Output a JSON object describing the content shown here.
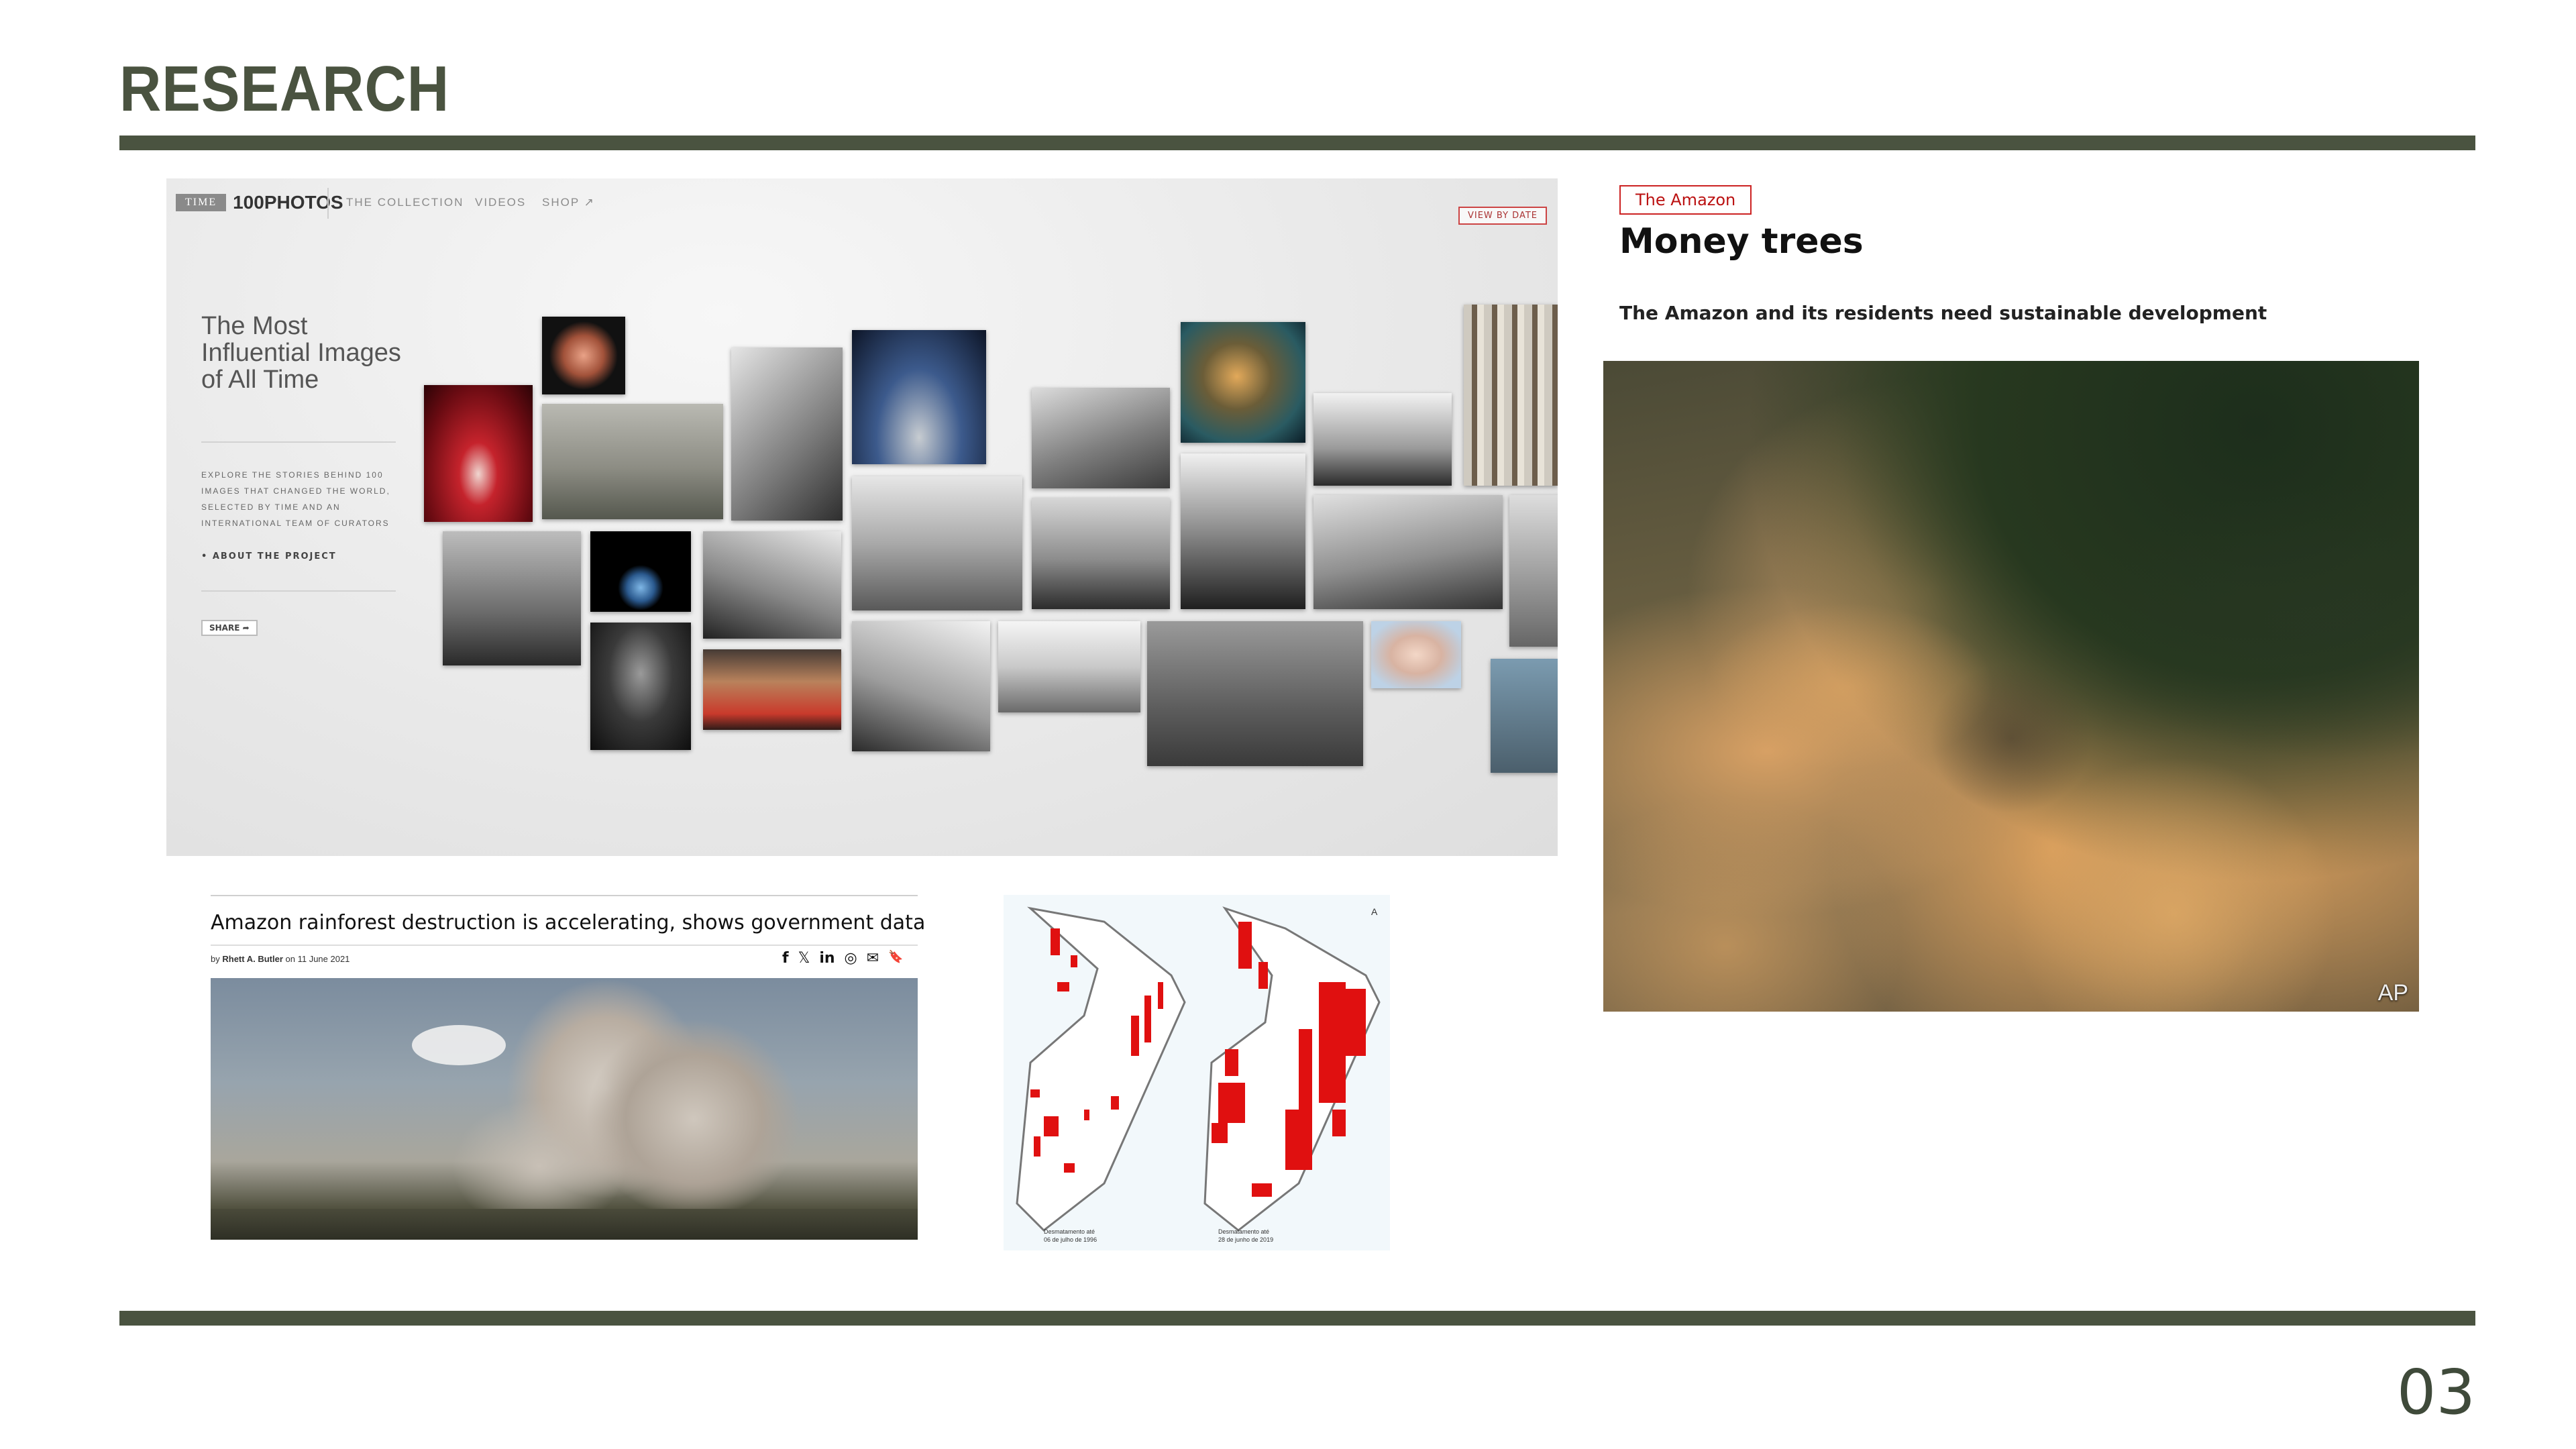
{
  "page": {
    "title": "RESEARCH",
    "page_number": "03",
    "accent_color": "#4a5340"
  },
  "time_panel": {
    "logo_box": "TIME",
    "logo_text": "100PHOTOS",
    "nav": [
      "THE COLLECTION",
      "VIDEOS",
      "SHOP ↗"
    ],
    "view_by_date": "VIEW BY DATE",
    "heading": "The Most Influential Images of All Time",
    "blurb": "EXPLORE THE STORIES BEHIND 100 IMAGES THAT CHANGED THE WORLD, SELECTED BY TIME AND AN INTERNATIONAL TEAM OF CURATORS",
    "about": "• ABOUT THE PROJECT",
    "share": "SHARE ➦"
  },
  "amazon_article": {
    "tag": "The Amazon",
    "headline": "Money trees",
    "subhead": "The Amazon and its residents need sustainable development",
    "photo_credit": "AP"
  },
  "mongabay_article": {
    "title": "Amazon rainforest destruction is accelerating, shows government data",
    "byline_prefix": "by",
    "author": "Rhett A. Butler",
    "date_text": "on 11 June 2021",
    "share_icons": [
      "f",
      "𝕏",
      "in",
      "◎",
      "✉",
      "🔖"
    ]
  },
  "maps": {
    "left_caption_1": "Desmatamento até",
    "left_caption_2": "06 de julho de 1996",
    "right_caption_1": "Desmatamento até",
    "right_caption_2": "28 de junho de 2019",
    "north_mark": "A"
  }
}
